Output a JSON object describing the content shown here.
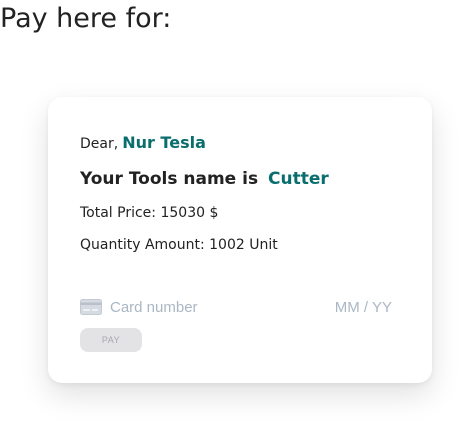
{
  "heading": "Pay here for:",
  "payment_card": {
    "dear_label": "Dear,",
    "customer_name": "Nur Tesla",
    "tools_label": "Your Tools name is",
    "tool_name": "Cutter",
    "total_price_label": "Total Price: 15030 $",
    "quantity_label": "Quantity Amount: 1002 Unit"
  },
  "card_form": {
    "card_number_placeholder": "Card number",
    "expiry_placeholder": "MM / YY",
    "pay_button_label": "PAY",
    "card_icon": "credit-card-icon"
  },
  "colors": {
    "accent": "#0b6e6e",
    "placeholder": "#aab7c4",
    "button_bg": "#e3e3e6"
  }
}
